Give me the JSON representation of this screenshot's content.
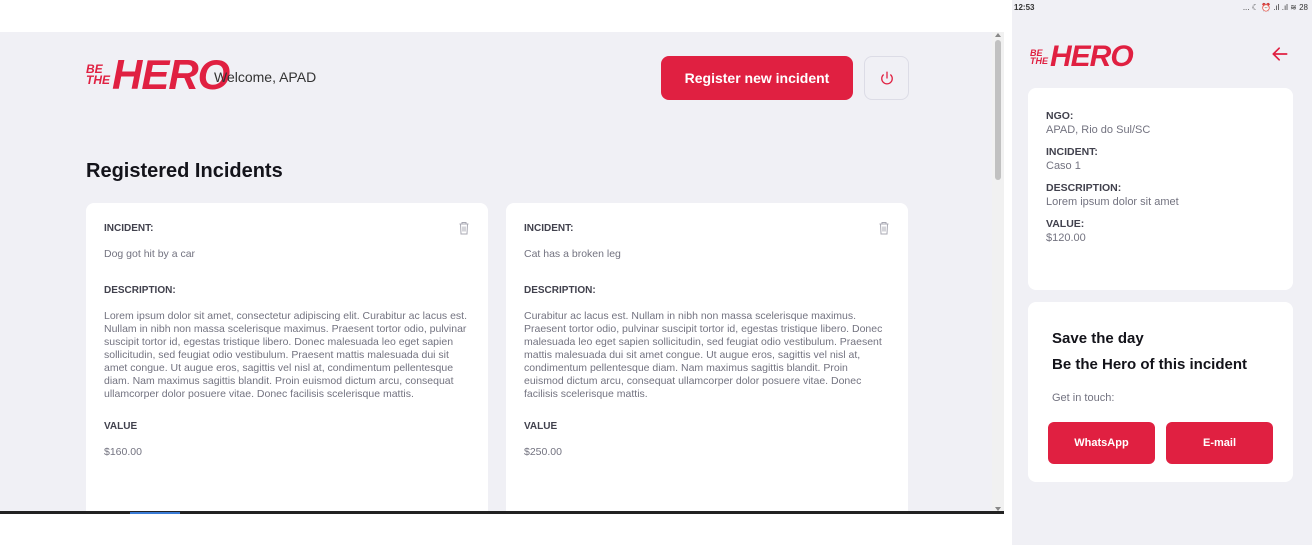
{
  "brand": {
    "logo_small": [
      "BE",
      "THE"
    ],
    "logo_big": "HERO",
    "accent": "#e02041",
    "background": "#f0f0f5"
  },
  "desktop": {
    "welcome": "Welcome, APAD",
    "register_label": "Register new incident",
    "power_icon": "power-icon",
    "section_title": "Registered Incidents",
    "incidents": [
      {
        "incident_label": "INCIDENT:",
        "incident": "Dog got hit by a car",
        "description_label": "DESCRIPTION:",
        "description": "Lorem ipsum dolor sit amet, consectetur adipiscing elit. Curabitur ac lacus est. Nullam in nibh non massa scelerisque maximus. Praesent tortor odio, pulvinar suscipit tortor id, egestas tristique libero. Donec malesuada leo eget sapien sollicitudin, sed feugiat odio vestibulum. Praesent mattis malesuada dui sit amet congue. Ut augue eros, sagittis vel nisl at, condimentum pellentesque diam. Nam maximus sagittis blandit. Proin euismod dictum arcu, consequat ullamcorper dolor posuere vitae. Donec facilisis scelerisque mattis.",
        "value_label": "VALUE",
        "value": "$160.00"
      },
      {
        "incident_label": "INCIDENT:",
        "incident": "Cat has a broken leg",
        "description_label": "DESCRIPTION:",
        "description": "Curabitur ac lacus est. Nullam in nibh non massa scelerisque maximus. Praesent tortor odio, pulvinar suscipit tortor id, egestas tristique libero. Donec malesuada leo eget sapien sollicitudin, sed feugiat odio vestibulum. Praesent mattis malesuada dui sit amet congue. Ut augue eros, sagittis vel nisl at, condimentum pellentesque diam. Nam maximus sagittis blandit. Proin euismod dictum arcu, consequat ullamcorper dolor posuere vitae. Donec facilisis scelerisque mattis.",
        "value_label": "VALUE",
        "value": "$250.00"
      }
    ]
  },
  "mobile": {
    "status_time": "12:53",
    "status_icons": "... ☾ ⏰ .ıl .ıl ≋ 28",
    "detail": {
      "ngo_label": "NGO:",
      "ngo": "APAD, Rio do Sul/SC",
      "incident_label": "INCIDENT:",
      "incident": "Caso 1",
      "description_label": "DESCRIPTION:",
      "description": "Lorem ipsum dolor sit amet",
      "value_label": "VALUE:",
      "value": "$120.00"
    },
    "contact": {
      "title1": "Save the day",
      "title2": "Be the Hero of this incident",
      "get_in_touch": "Get in touch:",
      "whatsapp": "WhatsApp",
      "email": "E-mail"
    }
  }
}
